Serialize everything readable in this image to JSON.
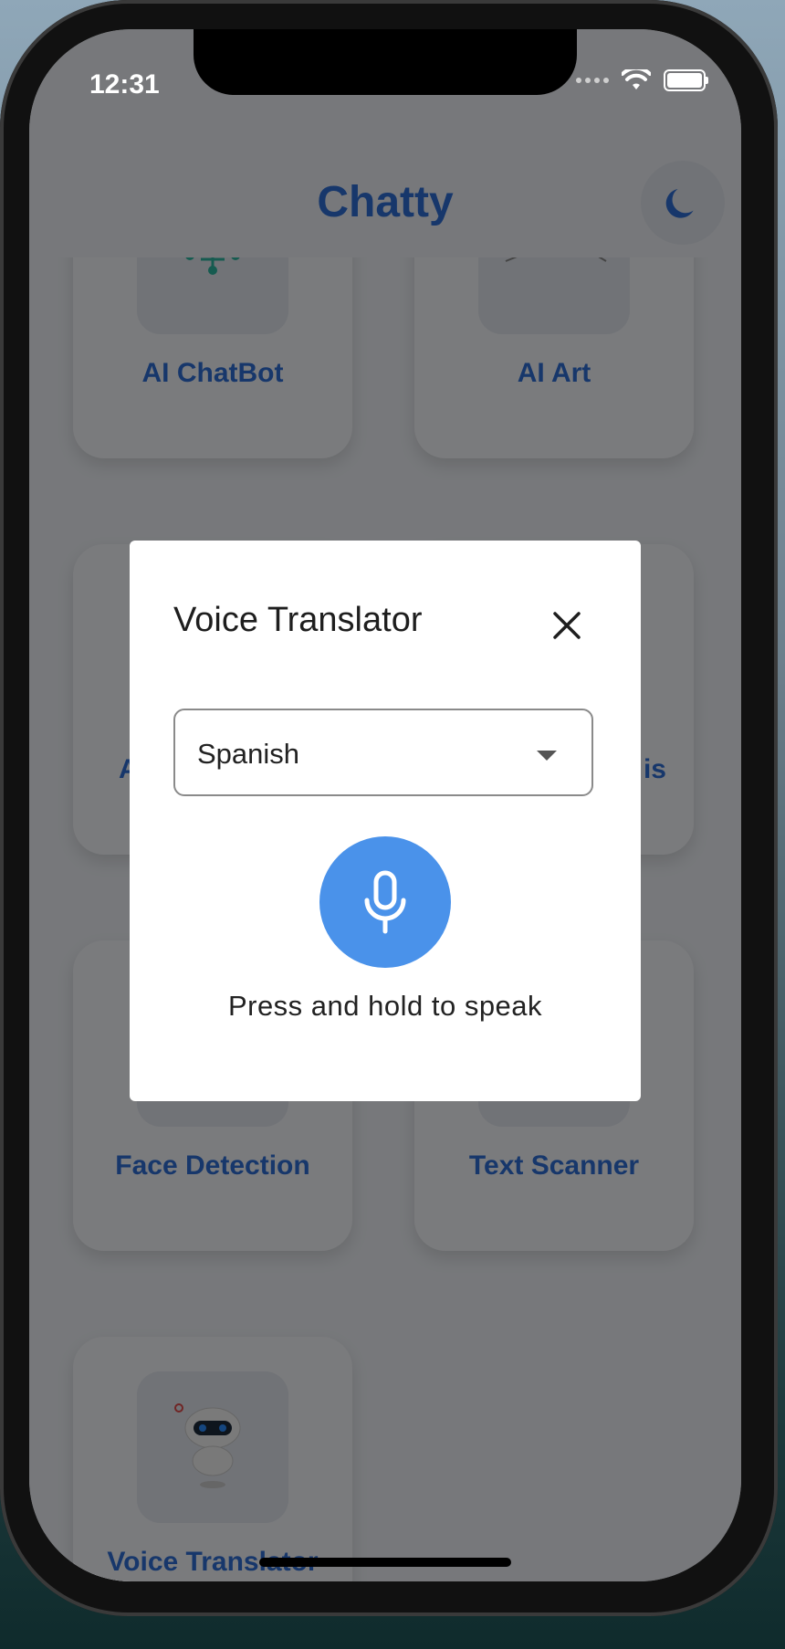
{
  "status_bar": {
    "time": "12:31"
  },
  "app": {
    "title": "Chatty",
    "theme_icon": "moon-icon"
  },
  "features": [
    {
      "label": "AI ChatBot",
      "icon": "ai-chip-icon"
    },
    {
      "label": "AI Art",
      "icon": "ai-art-icon"
    },
    {
      "label": "AI",
      "icon": "feature-icon"
    },
    {
      "label": "is",
      "icon": "feature-icon"
    },
    {
      "label": "Face Detection",
      "icon": "face-detection-icon"
    },
    {
      "label": "Text Scanner",
      "icon": "text-scanner-icon"
    },
    {
      "label": "Voice Translator",
      "icon": "robot-icon"
    }
  ],
  "dialog": {
    "title": "Voice Translator",
    "language_value": "Spanish",
    "hint": "Press and hold to speak"
  },
  "colors": {
    "accent": "#2f6fd6",
    "mic_button": "#4a92ea"
  }
}
